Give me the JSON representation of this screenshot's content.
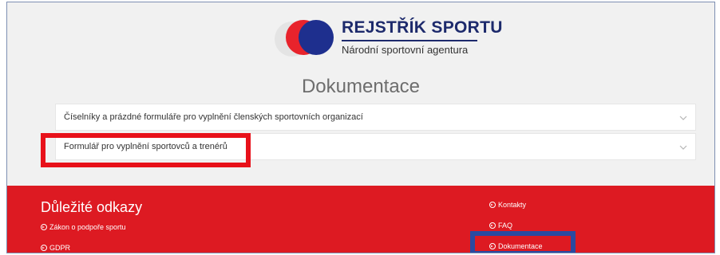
{
  "brand": {
    "title": "REJSTŘÍK SPORTU",
    "subtitle": "Národní sportovní agentura",
    "colors": {
      "red": "#e8232c",
      "blue": "#1e2f8e",
      "grey": "#e4e4e4"
    }
  },
  "page": {
    "title": "Dokumentace"
  },
  "accordion": {
    "items": [
      {
        "label": "Číselníky a prázdné formuláře pro vyplnění členských sportovních organizací",
        "icon": "chevron-down-icon"
      },
      {
        "label": "Formulář pro vyplnění sportovců a trenérů",
        "icon": "chevron-down-icon"
      }
    ]
  },
  "footer": {
    "heading": "Důležité odkazy",
    "background": "#dd1a22",
    "left_links": [
      {
        "label": "Zákon o podpoře sportu",
        "icon": "arrow-circle-icon"
      },
      {
        "label": "GDPR",
        "icon": "arrow-circle-icon"
      }
    ],
    "right_links": [
      {
        "label": "Kontakty",
        "icon": "arrow-circle-icon"
      },
      {
        "label": "FAQ",
        "icon": "arrow-circle-icon"
      },
      {
        "label": "Dokumentace",
        "icon": "arrow-circle-icon"
      }
    ]
  },
  "annotations": {
    "highlight_red": "#e8111a",
    "highlight_blue": "#2b4aa0"
  }
}
